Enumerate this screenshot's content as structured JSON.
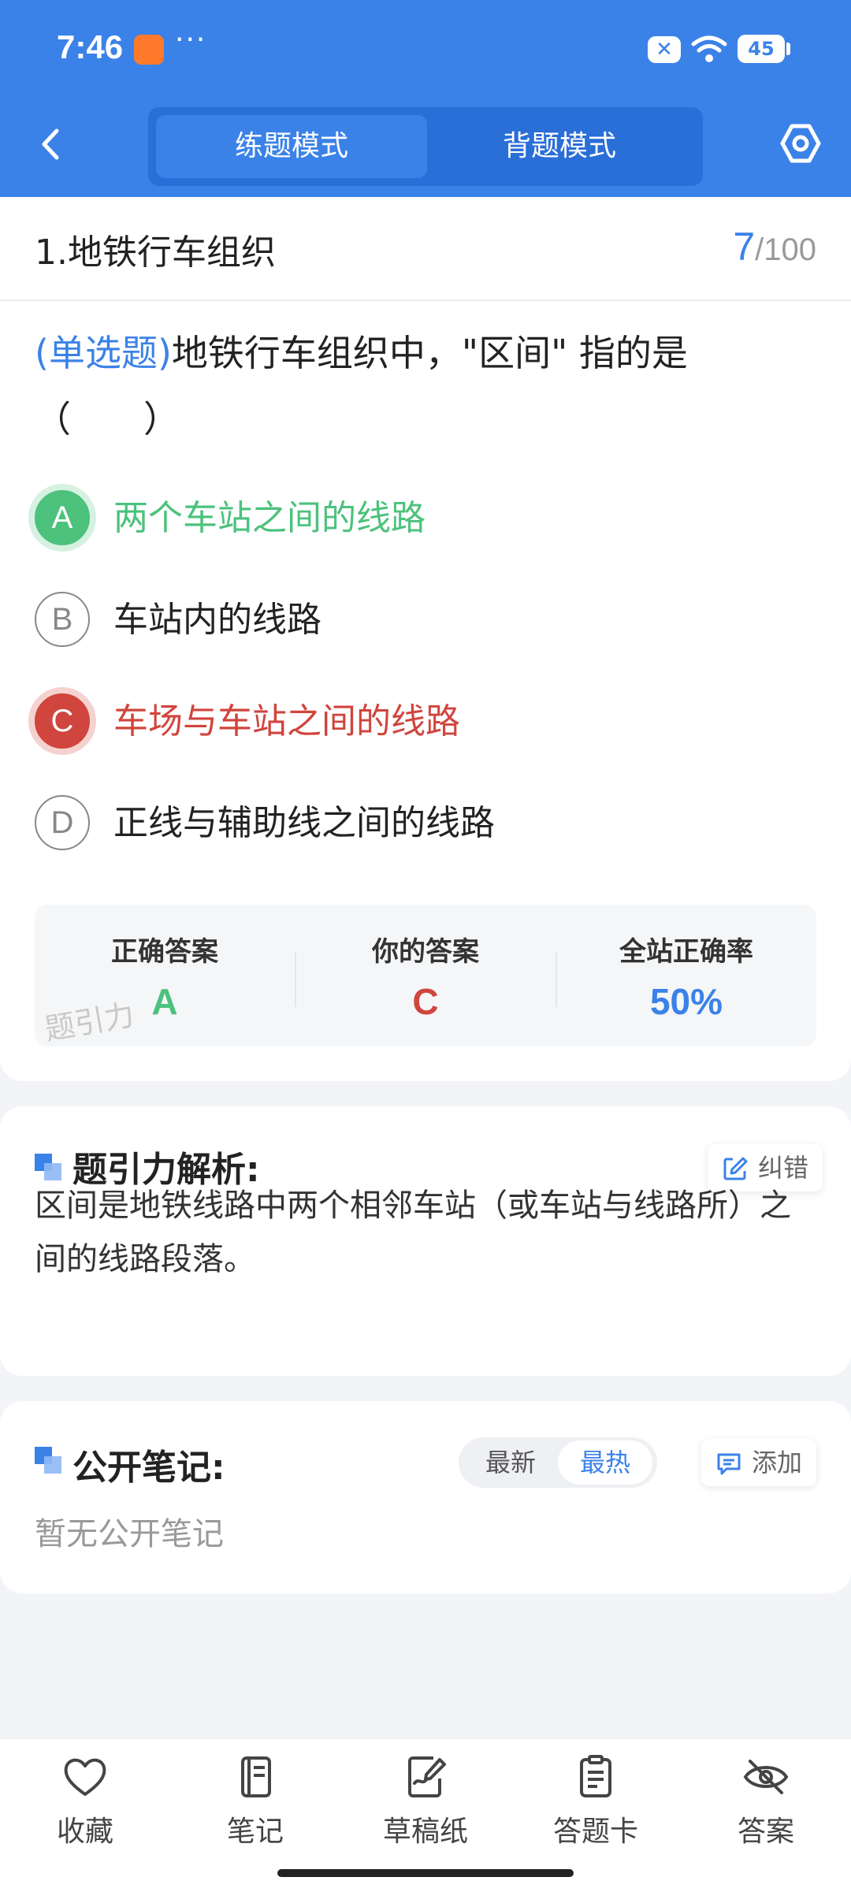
{
  "status_bar": {
    "time": "7:46",
    "more": "···",
    "battery": "45"
  },
  "header": {
    "tabs": [
      {
        "label": "练题模式",
        "active": true
      },
      {
        "label": "背题模式",
        "active": false
      }
    ],
    "accent_color": "#3b82e8"
  },
  "question": {
    "chapter": "1.地铁行车组织",
    "progress_current": "7",
    "progress_total": "/100",
    "type_label": "(单选题)",
    "text": "地铁行车组织中，\"区间\" 指的是",
    "blank": "（　　）",
    "options": [
      {
        "letter": "A",
        "text": "两个车站之间的线路",
        "state": "correct"
      },
      {
        "letter": "B",
        "text": "车站内的线路",
        "state": "normal"
      },
      {
        "letter": "C",
        "text": "车场与车站之间的线路",
        "state": "wrong"
      },
      {
        "letter": "D",
        "text": "正线与辅助线之间的线路",
        "state": "normal"
      }
    ]
  },
  "result": {
    "correct_label": "正确答案",
    "correct_value": "A",
    "yours_label": "你的答案",
    "yours_value": "C",
    "rate_label": "全站正确率",
    "rate_value": "50%",
    "watermark": "题引力",
    "colors": {
      "correct": "#4cc27c",
      "wrong": "#d0453d",
      "rate": "#3b82e8"
    }
  },
  "analysis": {
    "title": "题引力解析:",
    "report_label": "纠错",
    "text": "区间是地铁线路中两个相邻车站（或车站与线路所）之间的线路段落。"
  },
  "notes": {
    "title": "公开笔记:",
    "sort_options": [
      "最新",
      "最热"
    ],
    "sort_selected": "最热",
    "add_label": "添加",
    "empty_text": "暂无公开笔记"
  },
  "bottom_nav": [
    {
      "label": "收藏",
      "icon": "heart-icon"
    },
    {
      "label": "笔记",
      "icon": "notebook-icon"
    },
    {
      "label": "草稿纸",
      "icon": "draft-paper-icon"
    },
    {
      "label": "答题卡",
      "icon": "answer-sheet-icon"
    },
    {
      "label": "答案",
      "icon": "eye-off-icon"
    }
  ]
}
